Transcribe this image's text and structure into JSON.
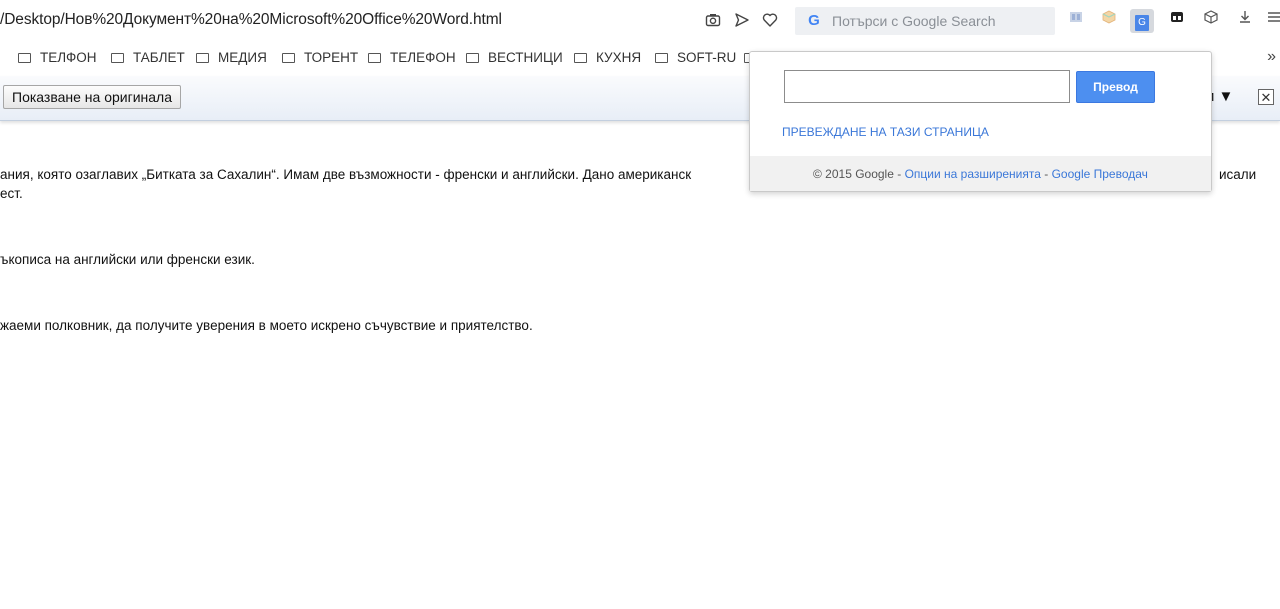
{
  "browser": {
    "url": "/Desktop/Нов%20Документ%20на%20Microsoft%20Office%20Word.html",
    "search_placeholder": "Потърси с Google Search",
    "icons": [
      "camera-icon",
      "send-icon",
      "heart-icon",
      "google-g-icon",
      "extension-icon",
      "translate-extension-icon",
      "tab-icon",
      "cube-icon",
      "download-icon",
      "menu-icon"
    ]
  },
  "bookmarks": {
    "items": [
      "ТЕЛФОН",
      "ТАБЛЕТ",
      "МЕДИЯ",
      "ТОРЕНТ",
      "ТЕЛЕФОН",
      "ВЕСТНИЦИ",
      "КУХНЯ",
      "SOFT-RU"
    ],
    "more": "»"
  },
  "translate_bar": {
    "show_original_label": "Показване на оригинала",
    "options_truncated": "и ▼",
    "close_label": "✕"
  },
  "document": {
    "lines": [
      "ания, която озаглавих „Битката за Сахалин“. Имам две възможности - френски и английски. Дано американск",
      "ест.",
      "ъкописа на английски или френски език.",
      "жаеми полковник, да получите уверения в моето искрено съчувствие и приятелство."
    ],
    "right_fragment": "исали"
  },
  "popup": {
    "input_value": "",
    "translate_button": "Превод",
    "translate_page_link": "ПРЕВЕЖДАНЕ НА ТАЗИ СТРАНИЦА",
    "copyright": "© 2015 Google - ",
    "options_link": "Опции на разширенията",
    "separator": " - ",
    "google_translate_link": "Google Преводач"
  }
}
